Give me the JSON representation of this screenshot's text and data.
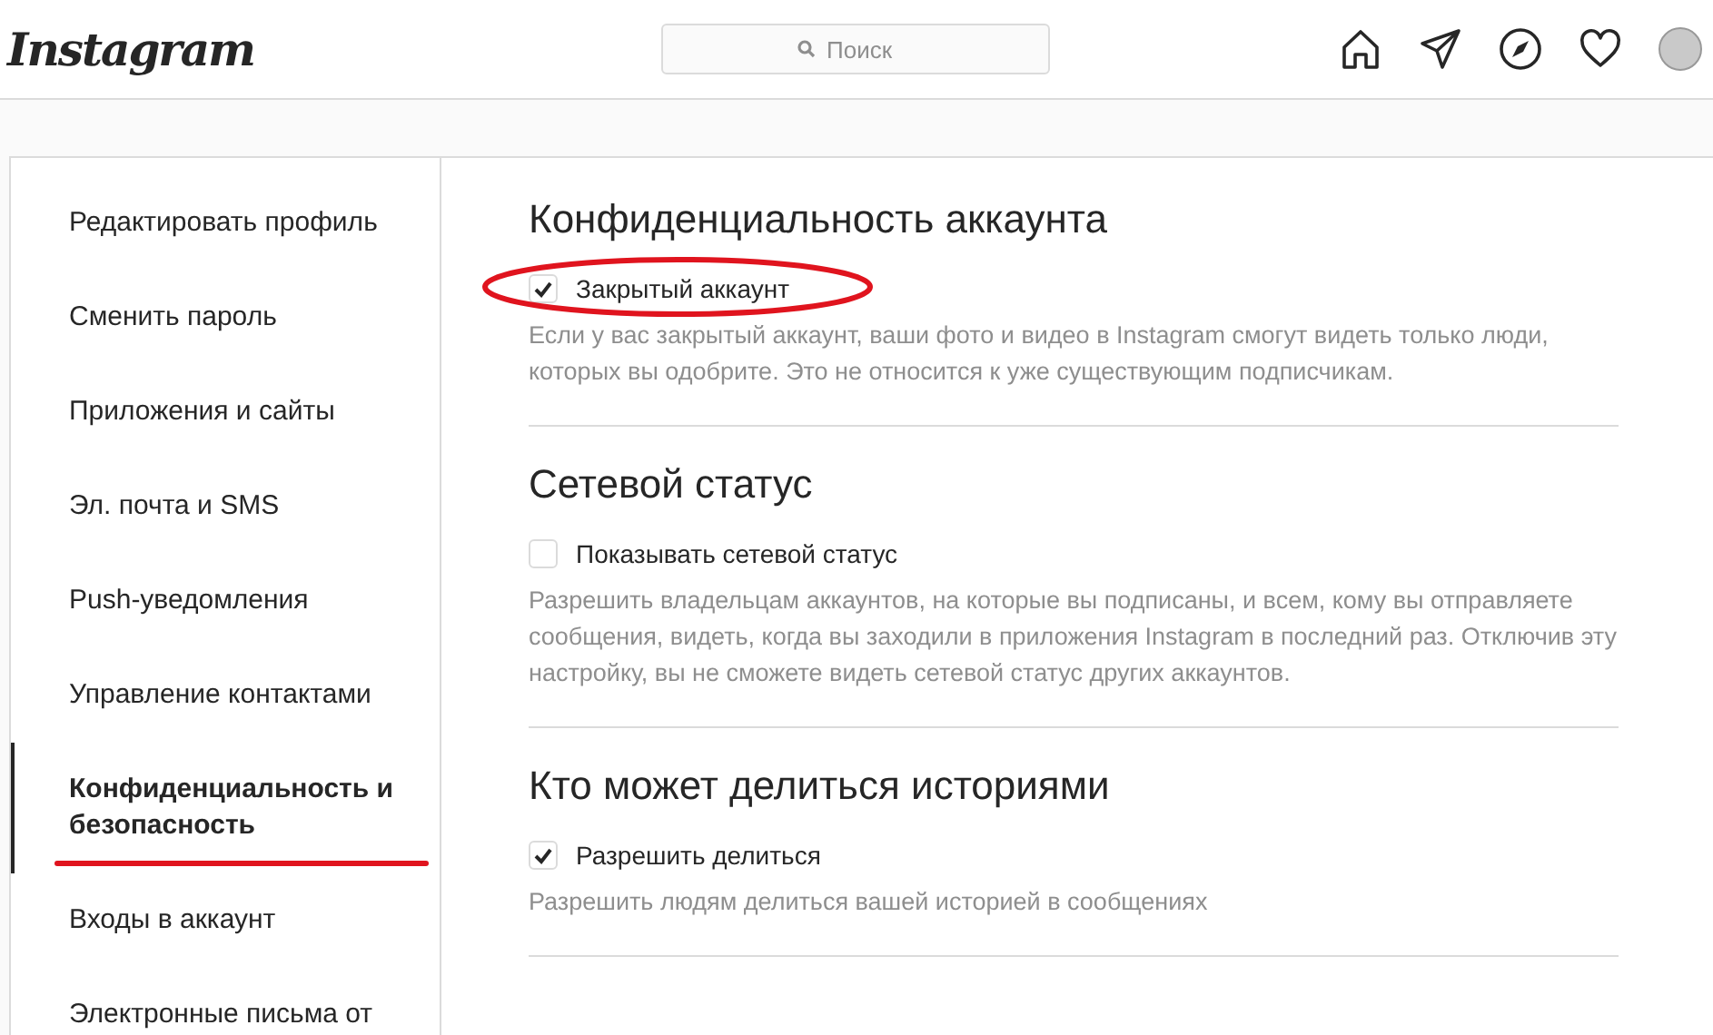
{
  "header": {
    "logo": "Instagram",
    "search": {
      "placeholder": "Поиск"
    }
  },
  "sidebar": {
    "items": [
      {
        "label": "Редактировать профиль",
        "selected": false,
        "underlined": false
      },
      {
        "label": "Сменить пароль",
        "selected": false,
        "underlined": false
      },
      {
        "label": "Приложения и сайты",
        "selected": false,
        "underlined": false
      },
      {
        "label": "Эл. почта и SMS",
        "selected": false,
        "underlined": false
      },
      {
        "label": "Push-уведомления",
        "selected": false,
        "underlined": false
      },
      {
        "label": "Управление контактами",
        "selected": false,
        "underlined": false
      },
      {
        "label": "Конфиденциальность и безопасность",
        "selected": true,
        "underlined": true
      },
      {
        "label": "Входы в аккаунт",
        "selected": false,
        "underlined": false
      },
      {
        "label": "Электронные письма от",
        "selected": false,
        "underlined": false
      }
    ]
  },
  "sections": [
    {
      "title": "Конфиденциальность аккаунта",
      "option": {
        "label": "Закрытый аккаунт",
        "checked": true,
        "circled": true
      },
      "description": "Если у вас закрытый аккаунт, ваши фото и видео в Instagram смогут видеть только люди, которых вы одобрите. Это не относится к уже существующим подписчикам."
    },
    {
      "title": "Сетевой статус",
      "option": {
        "label": "Показывать сетевой статус",
        "checked": false,
        "circled": false
      },
      "description": "Разрешить владельцам аккаунтов, на которые вы подписаны, и всем, кому вы отправляете сообщения, видеть, когда вы заходили в приложения Instagram в последний раз. Отключив эту настройку, вы не сможете видеть сетевой статус других аккаунтов."
    },
    {
      "title": "Кто может делиться историями",
      "option": {
        "label": "Разрешить делиться",
        "checked": true,
        "circled": false
      },
      "description": "Разрешить людям делиться вашей историей в сообщениях"
    }
  ]
}
